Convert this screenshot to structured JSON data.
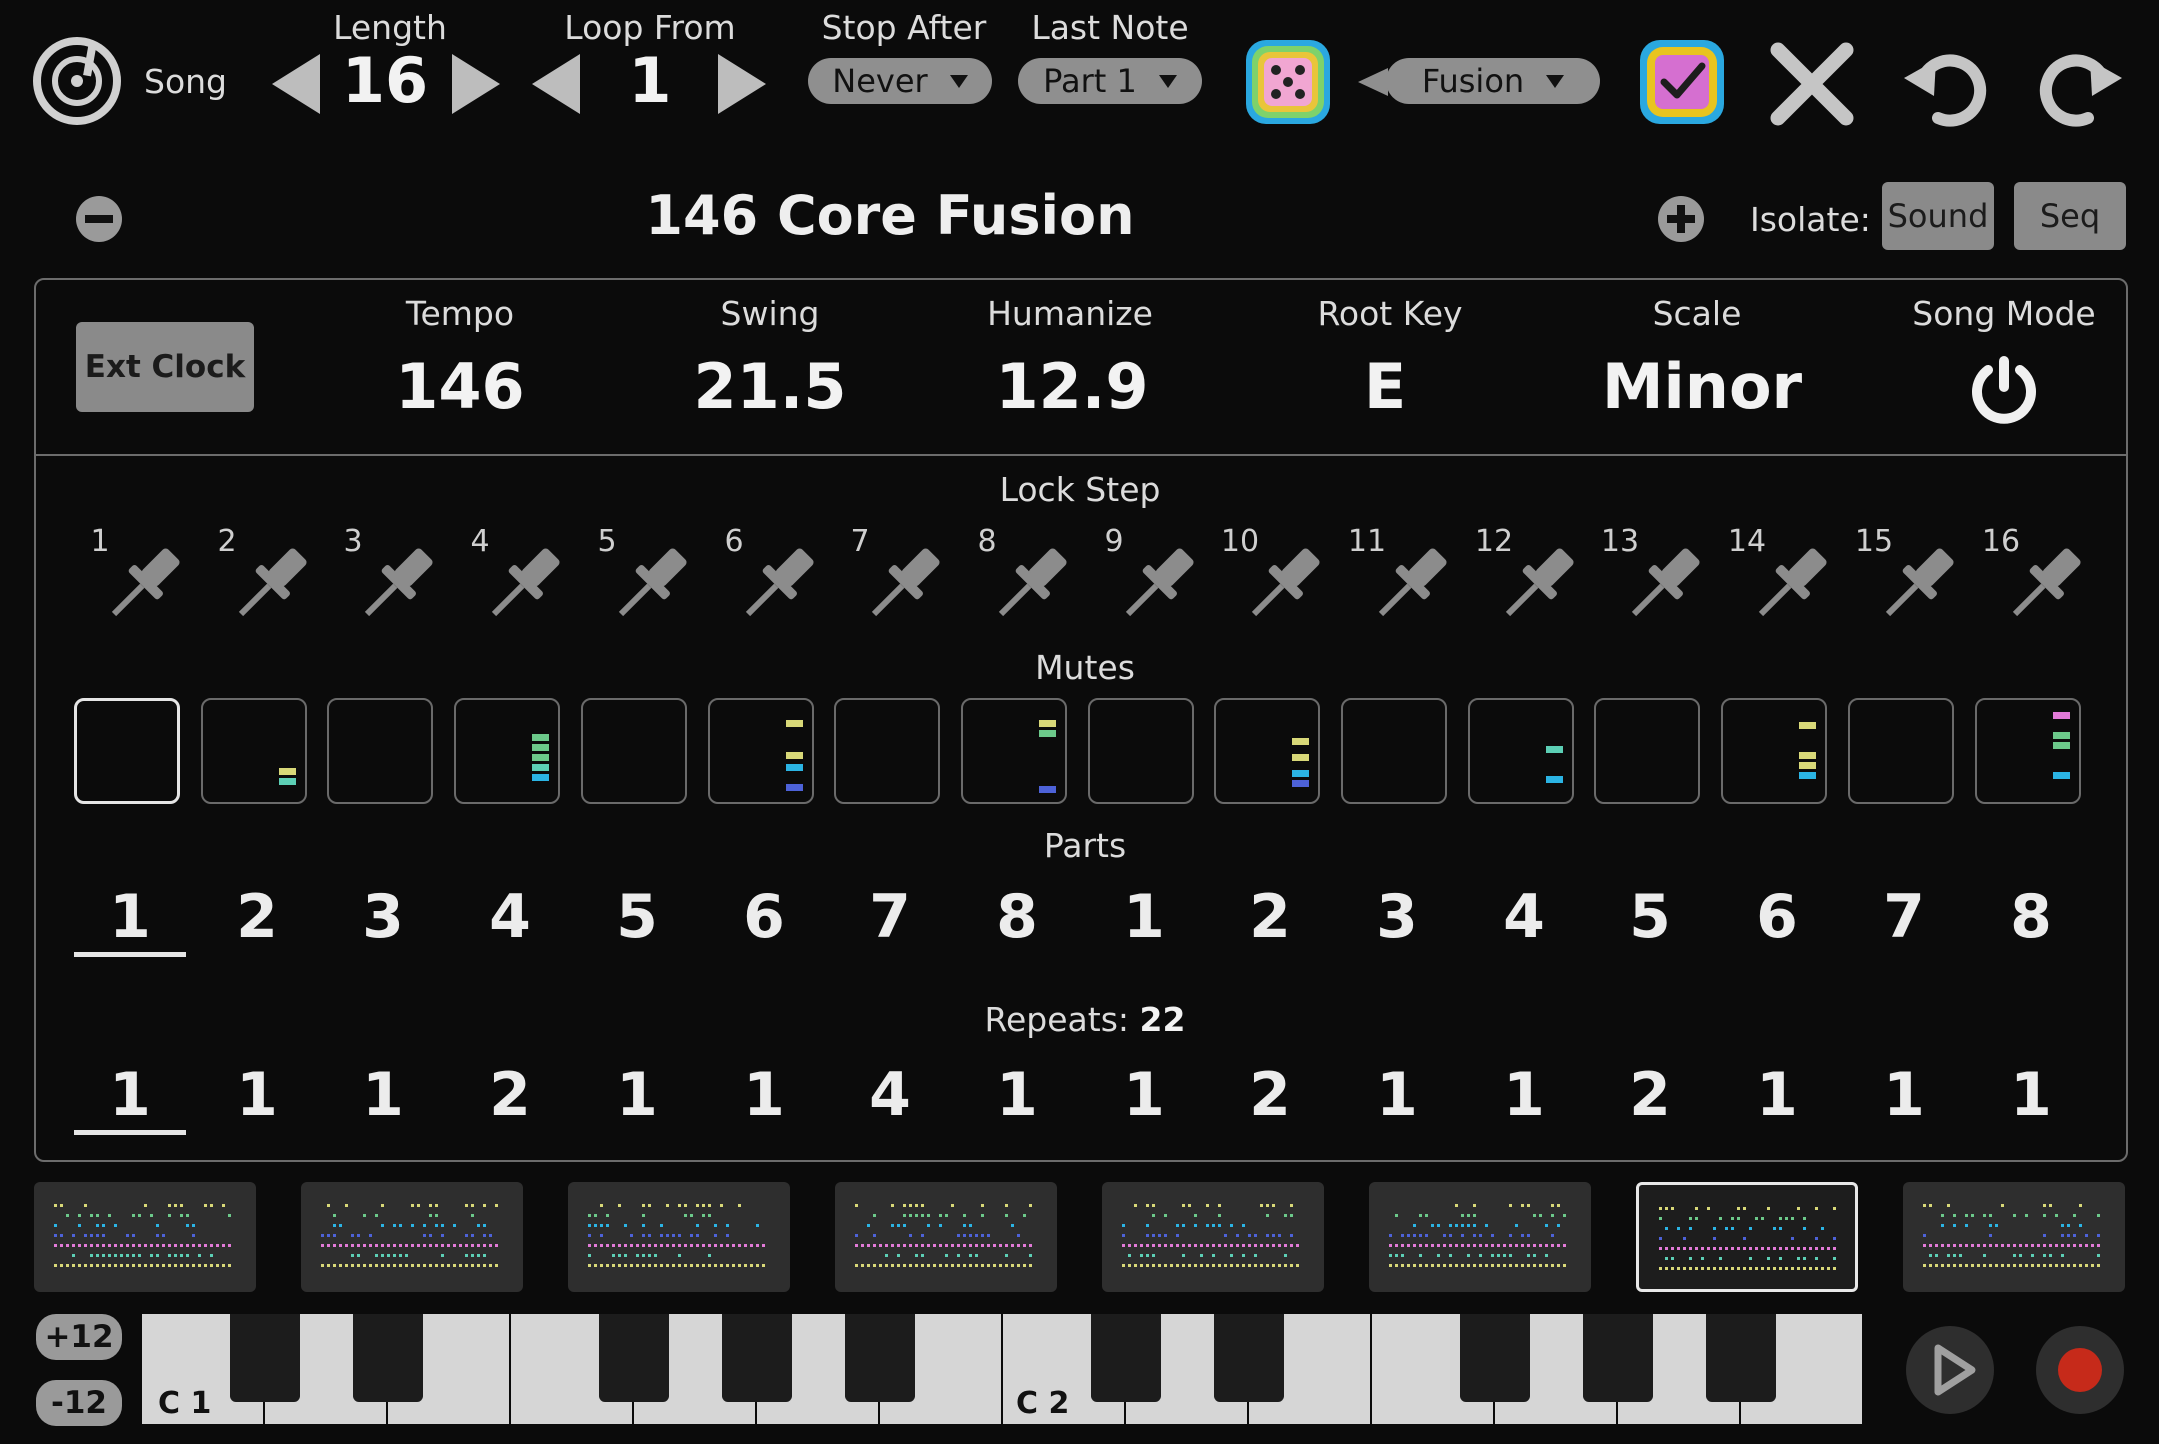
{
  "header": {
    "song_label": "Song",
    "length_label": "Length",
    "length_value": "16",
    "loop_from_label": "Loop From",
    "loop_from_value": "1",
    "stop_after_label": "Stop After",
    "stop_after_value": "Never",
    "last_note_label": "Last Note",
    "last_note_value": "Part 1",
    "style_value": "Fusion"
  },
  "title_bar": {
    "song_name": "146 Core Fusion",
    "isolate_label": "Isolate:",
    "sound_btn": "Sound",
    "seq_btn": "Seq"
  },
  "settings": {
    "ext_clock": "Ext Clock",
    "tempo_label": "Tempo",
    "tempo_value": "146",
    "swing_label": "Swing",
    "swing_value": "21.5",
    "humanize_label": "Humanize",
    "humanize_value": "12.9",
    "root_key_label": "Root Key",
    "root_key_value": "E",
    "scale_label": "Scale",
    "scale_value": "Minor",
    "song_mode_label": "Song Mode"
  },
  "lock_step": {
    "label": "Lock Step",
    "steps": [
      "1",
      "2",
      "3",
      "4",
      "5",
      "6",
      "7",
      "8",
      "9",
      "10",
      "11",
      "12",
      "13",
      "14",
      "15",
      "16"
    ]
  },
  "mutes": {
    "label": "Mutes",
    "selected_index": 0
  },
  "parts": {
    "label": "Parts",
    "values": [
      "1",
      "2",
      "3",
      "4",
      "5",
      "6",
      "7",
      "8",
      "1",
      "2",
      "3",
      "4",
      "5",
      "6",
      "7",
      "8"
    ],
    "selected_index": 0
  },
  "repeats": {
    "label": "Repeats:",
    "total": "22",
    "values": [
      "1",
      "1",
      "1",
      "2",
      "1",
      "1",
      "4",
      "1",
      "1",
      "2",
      "1",
      "1",
      "2",
      "1",
      "1",
      "1"
    ],
    "selected_index": 0
  },
  "patterns": {
    "count": 8,
    "selected_index": 6
  },
  "keyboard": {
    "octave_up": "+12",
    "octave_down": "-12",
    "c1_label": "C 1",
    "c2_label": "C 2"
  },
  "colors": {
    "accent_record": "#c62a1a",
    "dice_bg": "#f1a6d2",
    "check_bg": "#e8c41f",
    "bar_yellow": "#d8d878",
    "bar_green": "#6cc98a",
    "bar_cyan": "#2bb4e4",
    "bar_blue": "#4d62d8",
    "bar_pink": "#e27ad8",
    "bar_teal": "#5ccfb5"
  }
}
